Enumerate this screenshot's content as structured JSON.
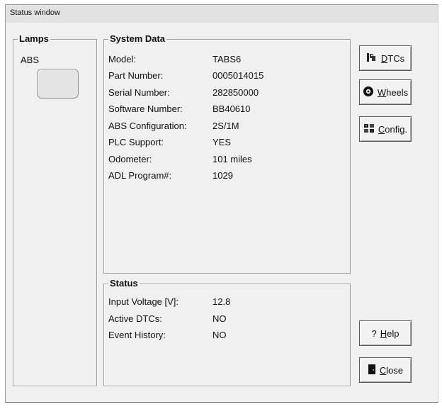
{
  "window": {
    "title": "Status window"
  },
  "lamps": {
    "legend": "Lamps",
    "abs_label": "ABS"
  },
  "system_data": {
    "legend": "System Data",
    "rows": [
      {
        "label": "Model:",
        "value": "TABS6"
      },
      {
        "label": "Part Number:",
        "value": "0005014015"
      },
      {
        "label": "Serial Number:",
        "value": "282850000"
      },
      {
        "label": "Software Number:",
        "value": "BB40610"
      },
      {
        "label": "ABS Configuration:",
        "value": "2S/1M"
      },
      {
        "label": "PLC Support:",
        "value": "YES"
      },
      {
        "label": "Odometer:",
        "value": "101 miles"
      },
      {
        "label": "ADL Program#:",
        "value": "1029"
      }
    ]
  },
  "status": {
    "legend": "Status",
    "rows": [
      {
        "label": "Input Voltage [V]:",
        "value": "12.8"
      },
      {
        "label": "Active DTCs:",
        "value": "NO"
      },
      {
        "label": "Event History:",
        "value": "NO"
      }
    ]
  },
  "buttons": {
    "dtcs": {
      "label": "DTCs",
      "icon": "dtc-tool-icon"
    },
    "wheels": {
      "label": "Wheels",
      "icon": "wheel-icon"
    },
    "config": {
      "label": "Config.",
      "icon": "config-icon"
    },
    "help": {
      "label": "Help",
      "icon": "question-mark-icon"
    },
    "close": {
      "label": "Close",
      "icon": "door-icon"
    }
  }
}
